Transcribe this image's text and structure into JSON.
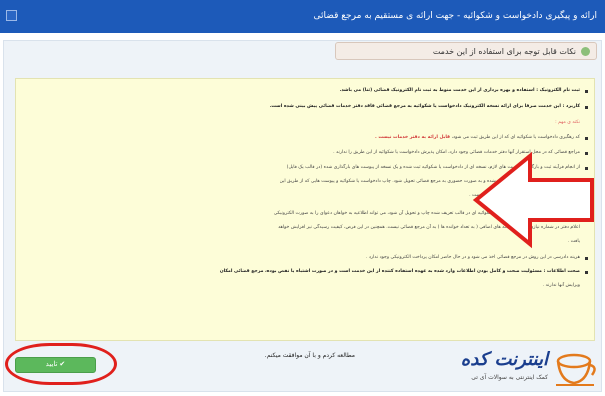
{
  "header": {
    "title": "ارائه و پیگیری دادخواست و شکوائیه - جهت ارائه ی مستقیم به مرجع قضائی"
  },
  "notice_tab": {
    "label": "نکات قابل توجه برای استفاده از این خدمت"
  },
  "notice": {
    "lines": [
      {
        "text": "ثبت نام الکترونیک : استفاده و بهره برداری از این خدمت منوط به ثبت نام الکترونیک قضائی (ثنا) می باشد.",
        "style": "bold",
        "bullet": true
      },
      {
        "text": "کاربرد : این خدمت صرفا برای ارائه نسخه الکترونیک دادخواست یا شکوائیه به مرجع قضائی فاقد دفتر خدمات قضائی پیش بینی شده است.",
        "style": "bold",
        "bullet": true
      },
      {
        "text": "نکته ی مهم :",
        "style": "red",
        "bullet": false
      },
      {
        "text": "کد رهگیری دادخواست یا شکوائیه ای که از این طریق ثبت می شود، ",
        "highlight": "قابل ارائه به دفتر خدمات نیست .",
        "style": "normal",
        "bullet": true
      },
      {
        "text": "مراجع قضائی که در محل استقرار آنها دفتر خدمات قضائی وجود دارد، امکان پذیرش دادخواست یا شکوائیه از این طریق را ندارند .",
        "style": "normal",
        "bullet": true
      },
      {
        "text": "از انجام فرآیند ثبت و بارگذاری پیوست های لازم، نسخه ای از دادخواست یا شکوائیه ثبت شده و یک نسخه از پیوست های بارگذاری شده (در قالب یک فایل)",
        "style": "normal",
        "bullet": true
      },
      {
        "text": "در سامانه پیش بینی شده است، چاپ گرفته شده و به صورت حضوری به مرجع قضائی تحویل شود. چاپ دادخواست یا شکوائیه و پیوست هایی که از طریق این",
        "style": "normal",
        "bullet": false
      },
      {
        "text": "سامانه اخذ نشده باشد، قابل ارائه به مرجع قضائی نیست .",
        "style": "normal",
        "bullet": false
      },
      {
        "text": "یک مرجع قضائی، در صورتی که دادخواست یا شکوائیه ای در قالب تعریف شده چاپ و تحویل آن شود، می تواند اطلاعیه به خواهان دعوای را به صورت الکترونیکی",
        "style": "normal",
        "bullet": true
      },
      {
        "text": "اعلام دفتر در شماره نیازی به ارائه نسخه های اضافی ( به تعداد خوانده ها ) به آن مرجع قضائی نیست. همچنین در این فرض، کیفیت رسیدگی نیز افزایش خواهد",
        "style": "normal",
        "bullet": false
      },
      {
        "text": "یافت .",
        "style": "normal",
        "bullet": false
      },
      {
        "text": "هزینه دادرسی در این روش در مرجع قضائی اخذ می شود و در حال حاضر امکان پرداخت الکترونیکی وجود ندارد .",
        "style": "normal",
        "bullet": true
      },
      {
        "text": "صحت اطلاعات : مسئولیت صحت و کامل بودن اطلاعات وارد شده به عهده استفاده کننده از این خدمت است و در صورت اشتباه یا نقص بوده، مرجع قضائی امکان",
        "style": "bold",
        "bullet": true
      },
      {
        "text": "ویرایش آنها ندارند .",
        "style": "normal",
        "bullet": false
      }
    ]
  },
  "agreement": {
    "text": "مطالعه کردم و با آن موافقت میکنم."
  },
  "confirm_button": {
    "label": "✔ تایید"
  },
  "watermark": {
    "brand": "اینترنت کده",
    "tagline": "کمک اینترنتی به سوالات آی تی"
  },
  "colors": {
    "header": "#1d5ab9",
    "notice_bg": "#fdfdd8",
    "confirm": "#5cb85c",
    "annotation": "#e0201c"
  }
}
